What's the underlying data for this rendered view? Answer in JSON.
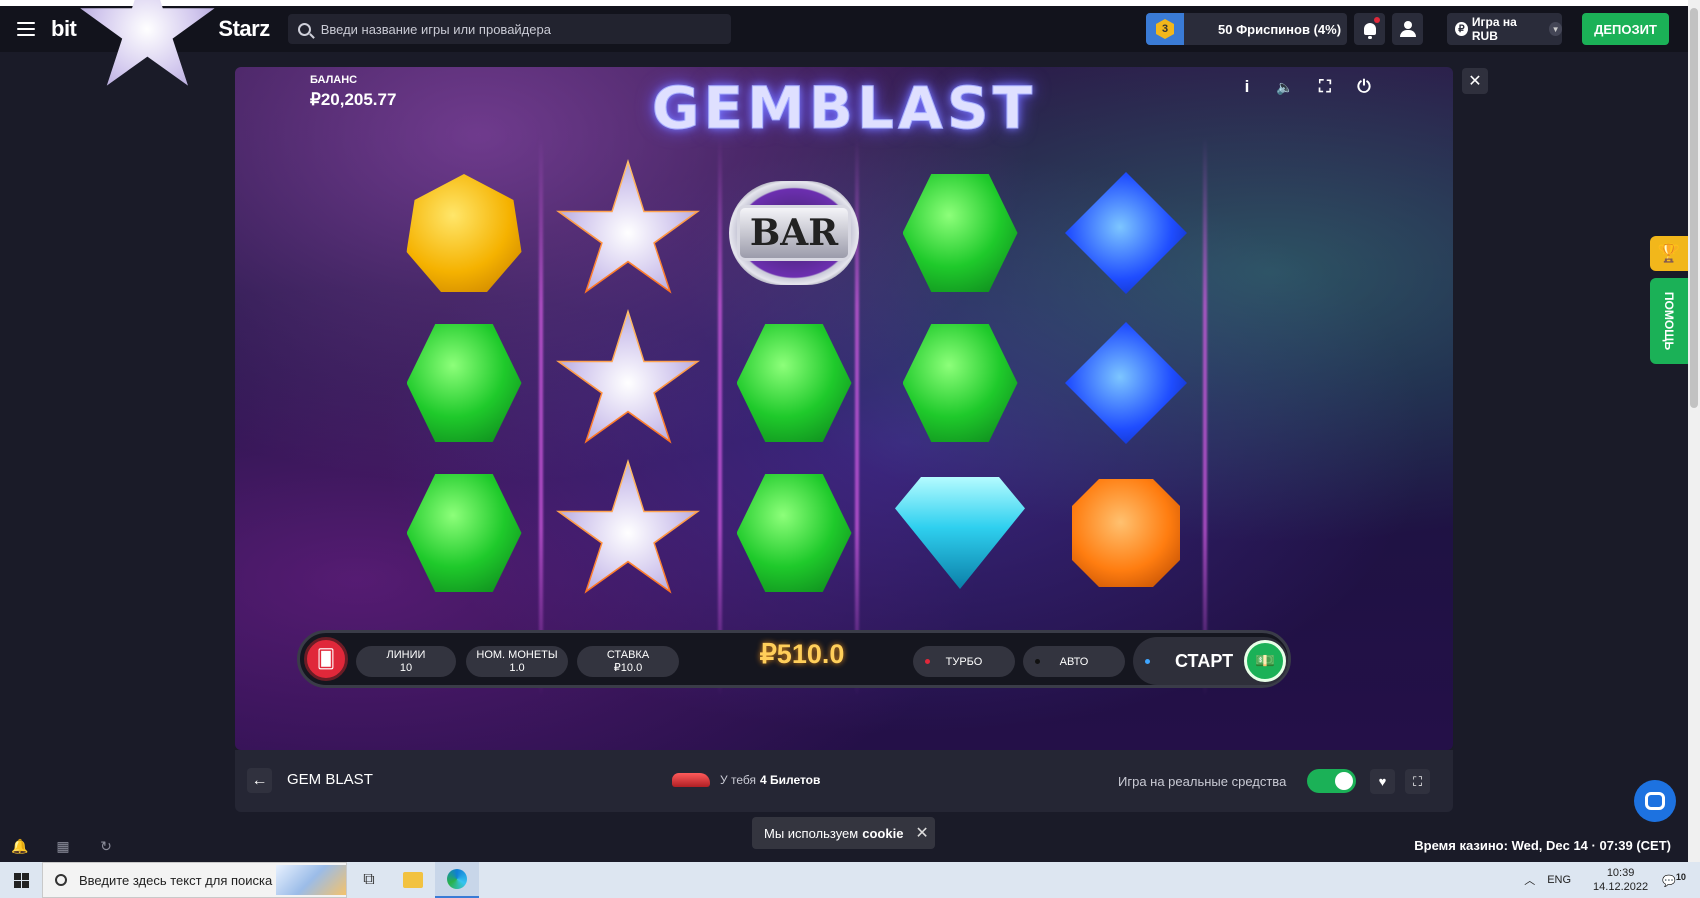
{
  "header": {
    "logo_left": "bit",
    "logo_star": "★",
    "logo_right": "Starz",
    "search_placeholder": "Введи название игры или провайдера",
    "level": "3",
    "freespins": "50 Фриспинов (4%)",
    "currency": "Игра на RUB",
    "currency_symbol": "₽",
    "deposit": "ДЕПОЗИТ"
  },
  "game": {
    "balance_label": "БАЛАНС",
    "balance_value": "₽20,205.77",
    "title": "GEMBLAST",
    "controls": {
      "info": "i",
      "sound": "🔈",
      "fullscreen": "⛶",
      "power": "⏻"
    },
    "reels": [
      [
        "yellow-hexagon-gem",
        "green-hexagon-gem",
        "green-hexagon-gem"
      ],
      [
        "star-symbol",
        "star-symbol",
        "star-symbol"
      ],
      [
        "bar-symbol",
        "green-hexagon-gem",
        "green-hexagon-gem"
      ],
      [
        "green-hexagon-gem",
        "green-hexagon-gem",
        "cyan-diamond-gem"
      ],
      [
        "blue-square-gem",
        "blue-square-gem",
        "orange-octagon-gem"
      ]
    ],
    "bar_text": "BAR",
    "lines_label": "ЛИНИИ",
    "lines_value": "10",
    "coin_label": "НОМ. МОНЕТЫ",
    "coin_value": "1.0",
    "bet_label": "СТАВКА",
    "bet_value": "₽10.0",
    "win_amount": "₽510.0",
    "turbo": "ТУРБО",
    "auto": "АВТО",
    "start": "СТАРТ"
  },
  "game_bar": {
    "name": "GEM BLAST",
    "tickets_prefix": "У тебя",
    "tickets_count": "4 Билетов",
    "real_money": "Игра на реальные средства",
    "real_money_on": true
  },
  "side": {
    "help": "ПОМОЩЬ"
  },
  "footer": {
    "cookie_text": "Мы используем",
    "cookie_bold": "cookie",
    "casino_time": "Время казино: Wed, Dec 14 · 07:39 (CET)"
  },
  "taskbar": {
    "search_placeholder": "Введите здесь текст для поиска",
    "lang": "ENG",
    "time": "10:39",
    "date": "14.12.2022",
    "notifications": "10"
  },
  "colors": {
    "accent_green": "#1bb157",
    "accent_red": "#e0283a",
    "gold": "#ffcf5a"
  }
}
